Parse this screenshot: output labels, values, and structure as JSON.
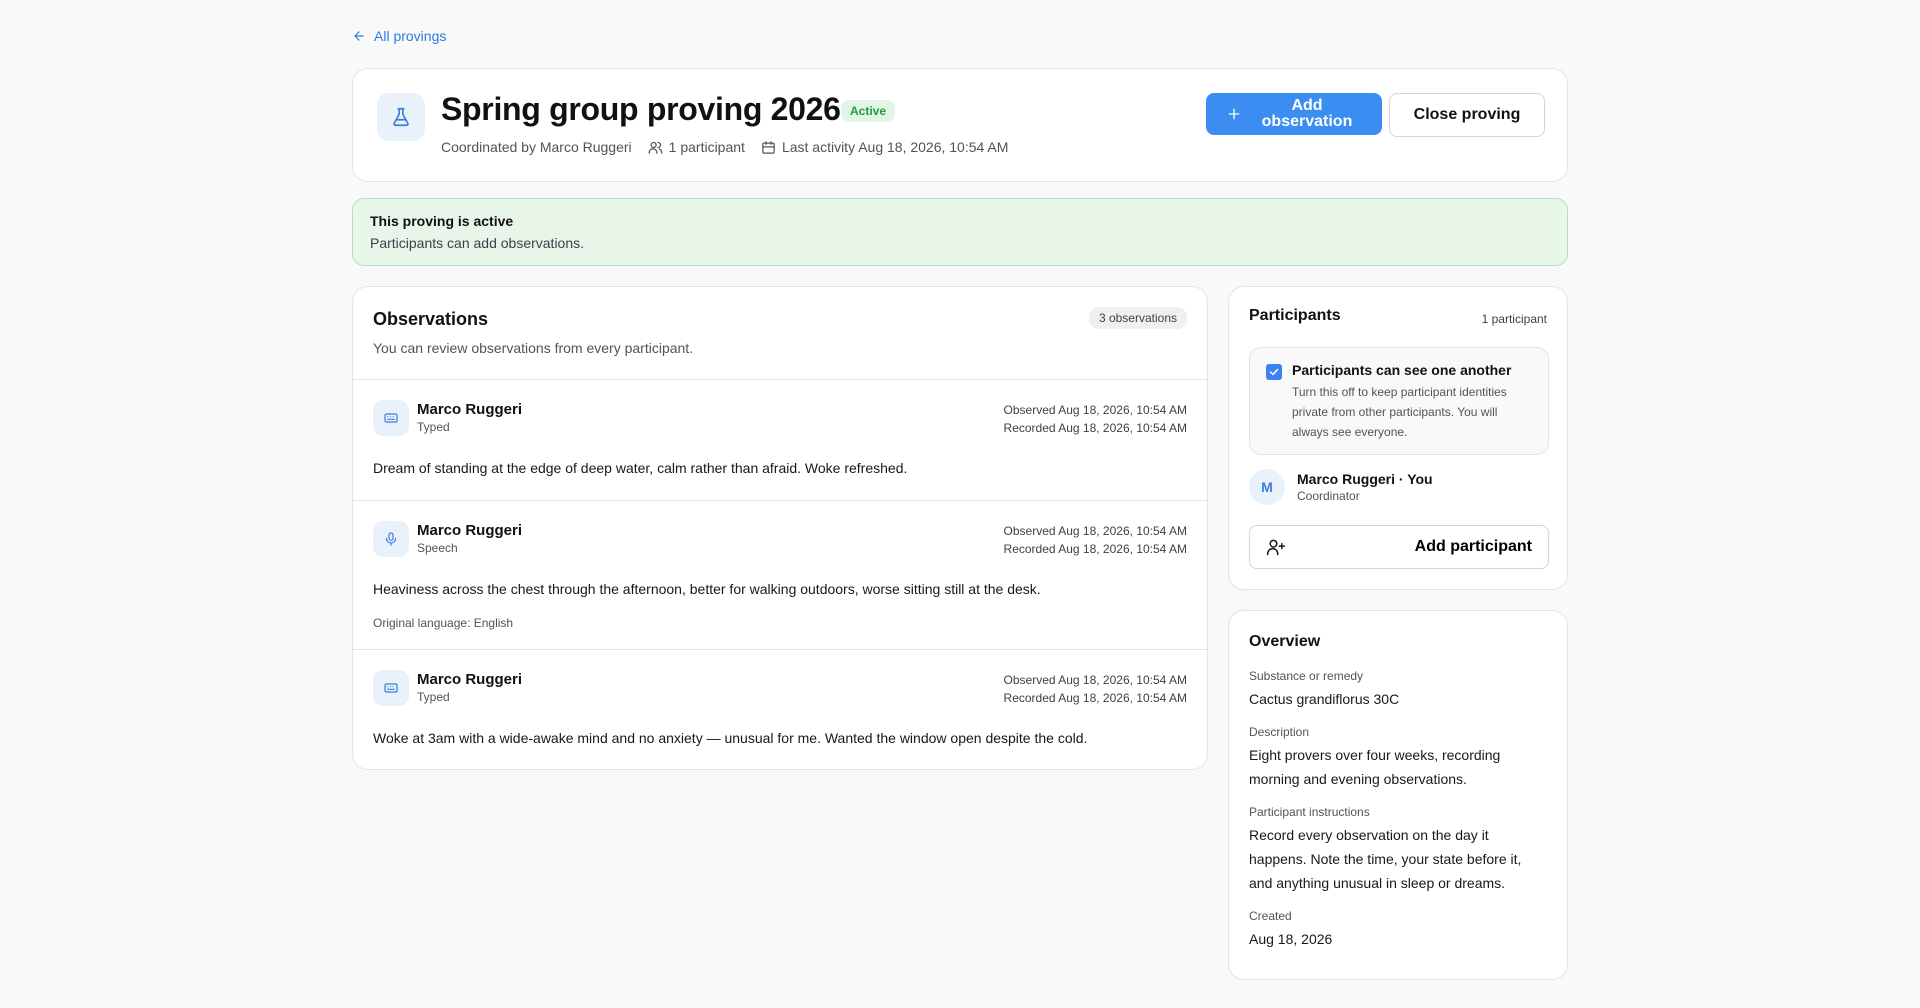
{
  "nav": {
    "back_label": "All provings"
  },
  "header": {
    "title": "Spring group proving 2026",
    "status": "Active",
    "coordinator": "Coordinated by Marco Ruggeri",
    "participants": "1 participant",
    "last_activity": "Last activity Aug 18, 2026, 10:54 AM",
    "add_button_line1": "Add",
    "add_button_line2": "observation",
    "close_button": "Close proving"
  },
  "alert": {
    "title": "This proving is active",
    "description": "Participants can add observations."
  },
  "observations": {
    "title": "Observations",
    "subtitle": "You can review observations from every participant.",
    "count": "3 observations",
    "items": [
      {
        "author": "Marco Ruggeri",
        "type": "Typed",
        "icon": "keyboard-icon",
        "observed": "Observed Aug 18, 2026, 10:54 AM",
        "recorded": "Recorded Aug 18, 2026, 10:54 AM",
        "text": "Dream of standing at the edge of deep water, calm rather than afraid. Woke refreshed."
      },
      {
        "author": "Marco Ruggeri",
        "type": "Speech",
        "icon": "microphone-icon",
        "observed": "Observed Aug 18, 2026, 10:54 AM",
        "recorded": "Recorded Aug 18, 2026, 10:54 AM",
        "text": "Heaviness across the chest through the afternoon, better for walking outdoors, worse sitting still at the desk.",
        "language": "Original language: English"
      },
      {
        "author": "Marco Ruggeri",
        "type": "Typed",
        "icon": "keyboard-icon",
        "observed": "Observed Aug 18, 2026, 10:54 AM",
        "recorded": "Recorded Aug 18, 2026, 10:54 AM",
        "text": "Woke at 3am with a wide-awake mind and no anxiety — unusual for me. Wanted the window open despite the cold."
      }
    ]
  },
  "participants": {
    "title": "Participants",
    "count": "1 participant",
    "visibility_title": "Participants can see one another",
    "visibility_desc": "Turn this off to keep participant identities private from other participants. You will always see everyone.",
    "visibility_checked": true,
    "member": {
      "initial": "M",
      "name": "Marco Ruggeri · You",
      "role": "Coordinator"
    },
    "add_button": "Add participant"
  },
  "overview": {
    "title": "Overview",
    "substance_label": "Substance or remedy",
    "substance": "Cactus grandiflorus 30C",
    "description_label": "Description",
    "description": "Eight provers over four weeks, recording morning and evening observations.",
    "instructions_label": "Participant instructions",
    "instructions": "Record every observation on the day it happens. Note the time, your state before it, and anything unusual in sleep or dreams.",
    "created_label": "Created",
    "created": "Aug 18, 2026"
  },
  "colors": {
    "accent": "#3b8df2",
    "success_bg": "#e8f5e9",
    "success_text": "#1d9d3a"
  }
}
